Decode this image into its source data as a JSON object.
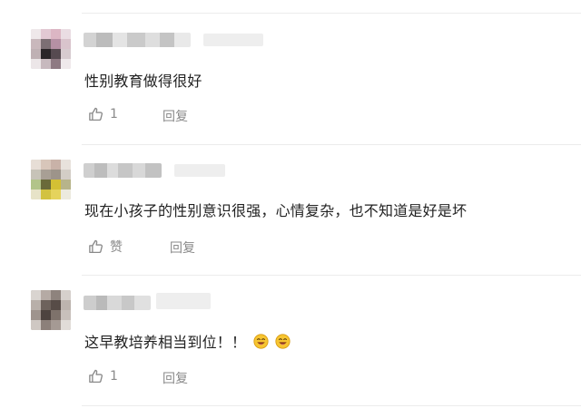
{
  "comments": [
    {
      "text": "性别教育做得很好",
      "like_count": "1",
      "reply_label": "回复"
    },
    {
      "text": "现在小孩子的性别意识很强，心情复杂，也不知道是好是坏",
      "like_label": "赞",
      "reply_label": "回复"
    },
    {
      "text": "这早教培养相当到位！！",
      "emoji": [
        "laugh-emoji",
        "laugh-emoji"
      ],
      "like_count": "1",
      "reply_label": "回复"
    }
  ],
  "icons": {
    "like": "thumbs-up-icon"
  },
  "colors": {
    "text": "#222222",
    "muted": "#8a8a8a",
    "divider": "#ececec"
  }
}
